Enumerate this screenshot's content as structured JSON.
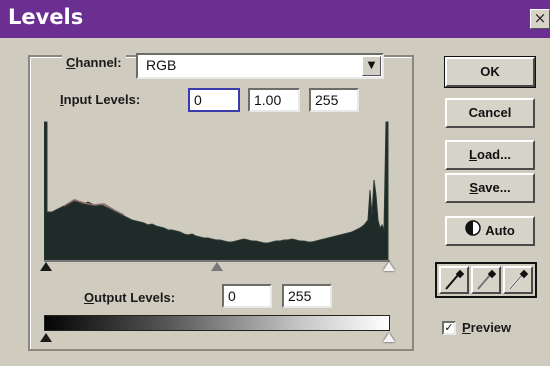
{
  "window": {
    "title": "Levels",
    "close_glyph": "×"
  },
  "channel": {
    "label_prefix": "C",
    "label_rest": "hannel:",
    "value": "RGB"
  },
  "input_levels": {
    "label_prefix": "I",
    "label_rest": "nput Levels:",
    "black": "0",
    "gamma": "1.00",
    "white": "255"
  },
  "output_levels": {
    "label_prefix": "O",
    "label_rest": "utput Levels:",
    "black": "0",
    "white": "255"
  },
  "buttons": {
    "ok": "OK",
    "cancel": "Cancel",
    "load_prefix": "L",
    "load_rest": "oad...",
    "save_prefix": "S",
    "save_rest": "ave...",
    "auto": "Auto"
  },
  "preview": {
    "label_prefix": "P",
    "label_rest": "review",
    "checked_glyph": "✓"
  },
  "icons": {
    "auto": "half-circle-icon",
    "black_eyedropper": "eyedropper-black-icon",
    "gray_eyedropper": "eyedropper-gray-icon",
    "white_eyedropper": "eyedropper-white-icon",
    "dropdown": "chevron-down-icon"
  },
  "colors": {
    "title_bar": "#6b2f91",
    "dialog_bg": "#cfccbf",
    "histogram_fill": "#1e2b28"
  }
}
